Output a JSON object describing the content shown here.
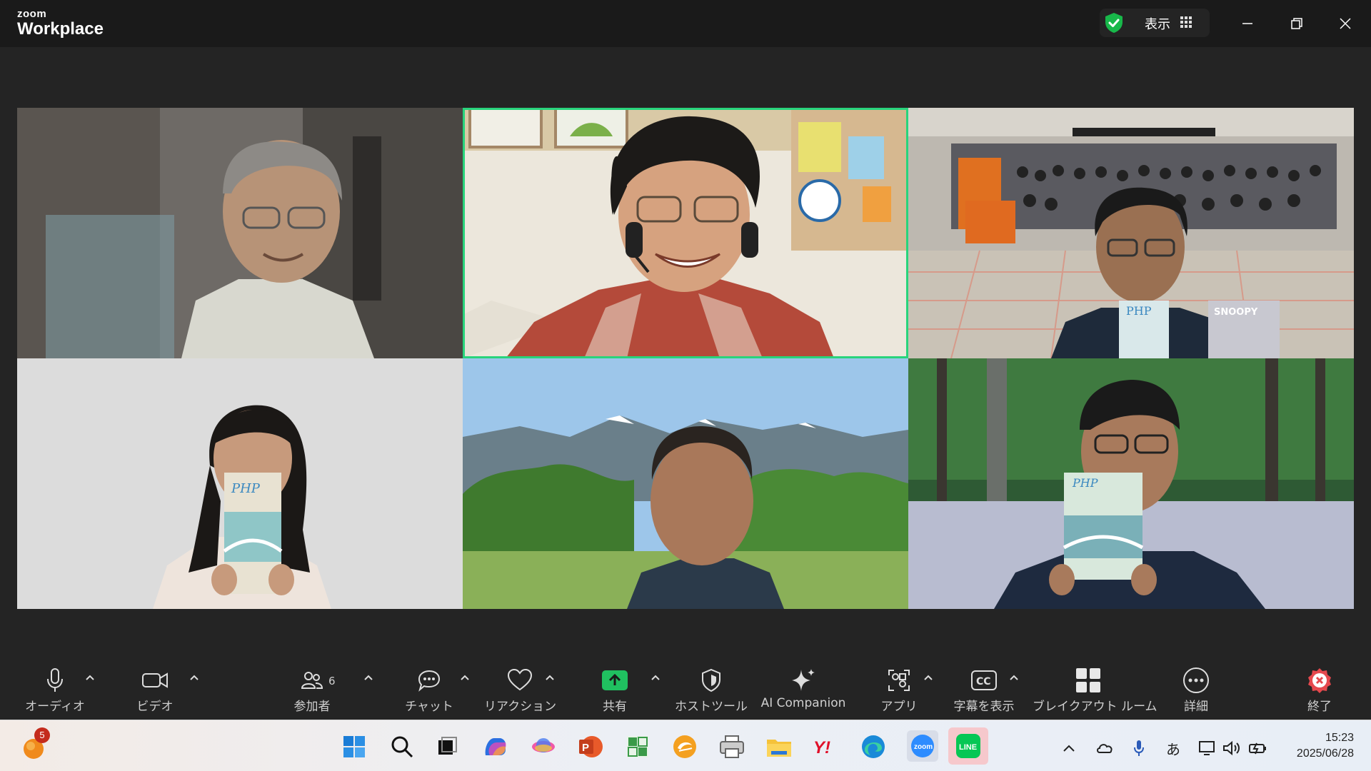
{
  "app": {
    "brand_small": "zoom",
    "brand_large": "Workplace"
  },
  "titlebar": {
    "view_label": "表示"
  },
  "participants": [
    {
      "tile": "participant-1",
      "active": false
    },
    {
      "tile": "participant-2",
      "active": true
    },
    {
      "tile": "participant-3",
      "active": false
    },
    {
      "tile": "participant-4",
      "active": false
    },
    {
      "tile": "participant-5",
      "active": false
    },
    {
      "tile": "participant-6",
      "active": false
    }
  ],
  "tile_texts": {
    "php": "PHP",
    "snoopy": "SNOOPY"
  },
  "toolbar": {
    "audio": "オーディオ",
    "video": "ビデオ",
    "participants": "参加者",
    "participants_count": "6",
    "chat": "チャット",
    "reactions": "リアクション",
    "share": "共有",
    "host_tools": "ホストツール",
    "ai_companion": "AI Companion",
    "apps": "アプリ",
    "captions": "字幕を表示",
    "breakout": "ブレイクアウト ルーム",
    "more": "詳細",
    "end": "終了"
  },
  "taskbar": {
    "notification_badge": "5",
    "ime": "あ",
    "time": "15:23",
    "date": "2025/06/28"
  },
  "colors": {
    "active_speaker": "#28d47c",
    "share": "#20c060",
    "end": "#e5484d"
  }
}
